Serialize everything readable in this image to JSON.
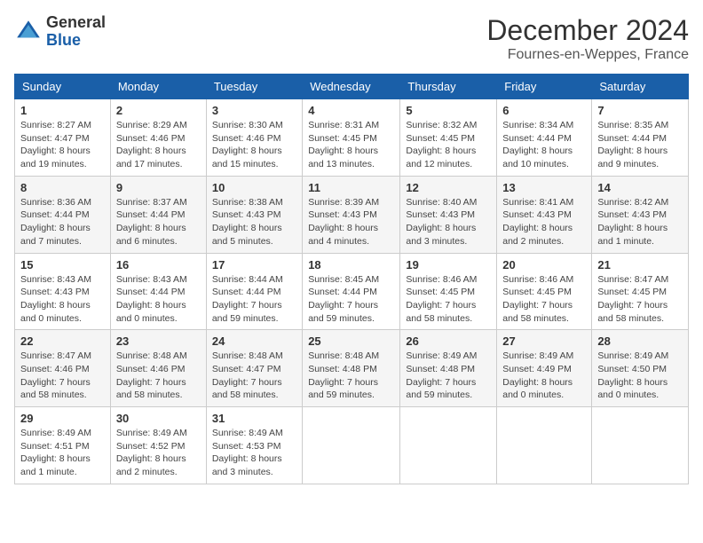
{
  "header": {
    "logo_general": "General",
    "logo_blue": "Blue",
    "month_title": "December 2024",
    "location": "Fournes-en-Weppes, France"
  },
  "days_of_week": [
    "Sunday",
    "Monday",
    "Tuesday",
    "Wednesday",
    "Thursday",
    "Friday",
    "Saturday"
  ],
  "weeks": [
    [
      {
        "day": "1",
        "sunrise": "8:27 AM",
        "sunset": "4:47 PM",
        "daylight": "8 hours and 19 minutes."
      },
      {
        "day": "2",
        "sunrise": "8:29 AM",
        "sunset": "4:46 PM",
        "daylight": "8 hours and 17 minutes."
      },
      {
        "day": "3",
        "sunrise": "8:30 AM",
        "sunset": "4:46 PM",
        "daylight": "8 hours and 15 minutes."
      },
      {
        "day": "4",
        "sunrise": "8:31 AM",
        "sunset": "4:45 PM",
        "daylight": "8 hours and 13 minutes."
      },
      {
        "day": "5",
        "sunrise": "8:32 AM",
        "sunset": "4:45 PM",
        "daylight": "8 hours and 12 minutes."
      },
      {
        "day": "6",
        "sunrise": "8:34 AM",
        "sunset": "4:44 PM",
        "daylight": "8 hours and 10 minutes."
      },
      {
        "day": "7",
        "sunrise": "8:35 AM",
        "sunset": "4:44 PM",
        "daylight": "8 hours and 9 minutes."
      }
    ],
    [
      {
        "day": "8",
        "sunrise": "8:36 AM",
        "sunset": "4:44 PM",
        "daylight": "8 hours and 7 minutes."
      },
      {
        "day": "9",
        "sunrise": "8:37 AM",
        "sunset": "4:44 PM",
        "daylight": "8 hours and 6 minutes."
      },
      {
        "day": "10",
        "sunrise": "8:38 AM",
        "sunset": "4:43 PM",
        "daylight": "8 hours and 5 minutes."
      },
      {
        "day": "11",
        "sunrise": "8:39 AM",
        "sunset": "4:43 PM",
        "daylight": "8 hours and 4 minutes."
      },
      {
        "day": "12",
        "sunrise": "8:40 AM",
        "sunset": "4:43 PM",
        "daylight": "8 hours and 3 minutes."
      },
      {
        "day": "13",
        "sunrise": "8:41 AM",
        "sunset": "4:43 PM",
        "daylight": "8 hours and 2 minutes."
      },
      {
        "day": "14",
        "sunrise": "8:42 AM",
        "sunset": "4:43 PM",
        "daylight": "8 hours and 1 minute."
      }
    ],
    [
      {
        "day": "15",
        "sunrise": "8:43 AM",
        "sunset": "4:43 PM",
        "daylight": "8 hours and 0 minutes."
      },
      {
        "day": "16",
        "sunrise": "8:43 AM",
        "sunset": "4:44 PM",
        "daylight": "8 hours and 0 minutes."
      },
      {
        "day": "17",
        "sunrise": "8:44 AM",
        "sunset": "4:44 PM",
        "daylight": "7 hours and 59 minutes."
      },
      {
        "day": "18",
        "sunrise": "8:45 AM",
        "sunset": "4:44 PM",
        "daylight": "7 hours and 59 minutes."
      },
      {
        "day": "19",
        "sunrise": "8:46 AM",
        "sunset": "4:45 PM",
        "daylight": "7 hours and 58 minutes."
      },
      {
        "day": "20",
        "sunrise": "8:46 AM",
        "sunset": "4:45 PM",
        "daylight": "7 hours and 58 minutes."
      },
      {
        "day": "21",
        "sunrise": "8:47 AM",
        "sunset": "4:45 PM",
        "daylight": "7 hours and 58 minutes."
      }
    ],
    [
      {
        "day": "22",
        "sunrise": "8:47 AM",
        "sunset": "4:46 PM",
        "daylight": "7 hours and 58 minutes."
      },
      {
        "day": "23",
        "sunrise": "8:48 AM",
        "sunset": "4:46 PM",
        "daylight": "7 hours and 58 minutes."
      },
      {
        "day": "24",
        "sunrise": "8:48 AM",
        "sunset": "4:47 PM",
        "daylight": "7 hours and 58 minutes."
      },
      {
        "day": "25",
        "sunrise": "8:48 AM",
        "sunset": "4:48 PM",
        "daylight": "7 hours and 59 minutes."
      },
      {
        "day": "26",
        "sunrise": "8:49 AM",
        "sunset": "4:48 PM",
        "daylight": "7 hours and 59 minutes."
      },
      {
        "day": "27",
        "sunrise": "8:49 AM",
        "sunset": "4:49 PM",
        "daylight": "8 hours and 0 minutes."
      },
      {
        "day": "28",
        "sunrise": "8:49 AM",
        "sunset": "4:50 PM",
        "daylight": "8 hours and 0 minutes."
      }
    ],
    [
      {
        "day": "29",
        "sunrise": "8:49 AM",
        "sunset": "4:51 PM",
        "daylight": "8 hours and 1 minute."
      },
      {
        "day": "30",
        "sunrise": "8:49 AM",
        "sunset": "4:52 PM",
        "daylight": "8 hours and 2 minutes."
      },
      {
        "day": "31",
        "sunrise": "8:49 AM",
        "sunset": "4:53 PM",
        "daylight": "8 hours and 3 minutes."
      },
      null,
      null,
      null,
      null
    ]
  ],
  "labels": {
    "sunrise": "Sunrise:",
    "sunset": "Sunset:",
    "daylight": "Daylight:"
  }
}
